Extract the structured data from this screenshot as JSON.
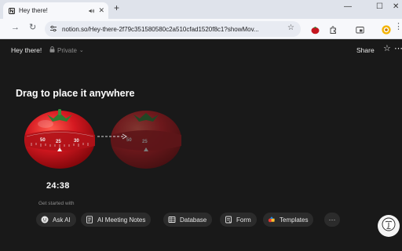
{
  "browser": {
    "tab_title": "Hey there!",
    "new_tab_label": "+",
    "address": "notion.so/Hey-there-2f79c351580580c2a510cfad1520f8c1?showMov..."
  },
  "app": {
    "page_title": "Hey there!",
    "privacy_label": "Private",
    "share_label": "Share"
  },
  "main": {
    "headline": "Drag to place it anywhere",
    "timer_display": "24:38",
    "dial_ticks": [
      "50",
      "25",
      "30"
    ],
    "dial_ticks_ghost": [
      "50",
      "25"
    ],
    "get_started_label": "Get started with",
    "chips": [
      {
        "label": "Ask AI",
        "icon": "ai-face-icon"
      },
      {
        "label": "AI Meeting Notes",
        "icon": "meeting-notes-icon"
      },
      {
        "label": "Database",
        "icon": "database-icon"
      },
      {
        "label": "Form",
        "icon": "form-icon"
      },
      {
        "label": "Templates",
        "icon": "templates-icon"
      }
    ],
    "more_label": "···"
  },
  "colors": {
    "background": "#191919",
    "chip_bg": "#2b2b2b",
    "tomato_red": "#c5161f",
    "tomato_leaf": "#2e7d32"
  }
}
